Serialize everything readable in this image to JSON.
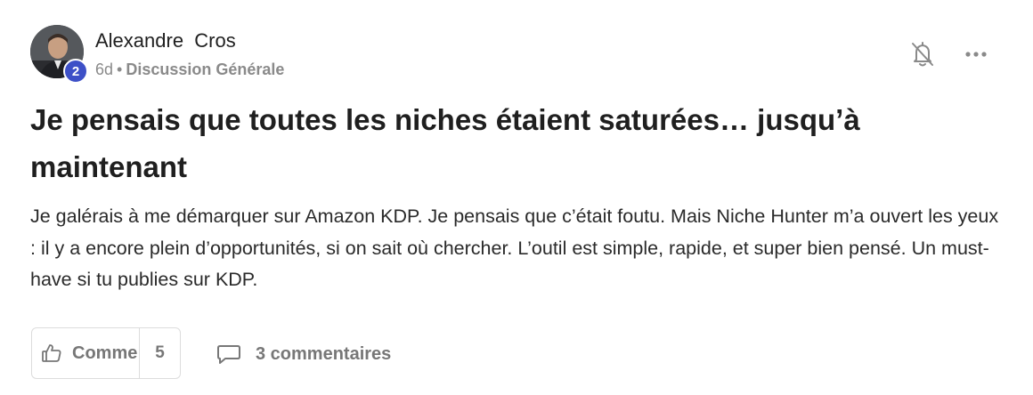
{
  "post": {
    "author": {
      "name": "Alexandre  Cros",
      "level": "2"
    },
    "meta": {
      "age": "6d",
      "separator": "•",
      "category": "Discussion Générale"
    },
    "title": "Je pensais que toutes les niches étaient saturées… jusqu’à maintenant",
    "body": "Je galérais à me démarquer sur Amazon KDP. Je pensais que c’était foutu. Mais Niche Hunter m’a ouvert les yeux : il y a encore plein d’opportunités, si on sait où chercher. L’outil est simple, rapide, et super bien pensé. Un must-have si tu publies sur KDP.",
    "actions": {
      "like_label": "Comme",
      "like_count": "5",
      "comments_label": "3 commentaires"
    },
    "icons": {
      "like": "thumbs-up-icon",
      "comment": "comment-bubble-icon",
      "notifications": "bell-off-icon",
      "more": "more-horizontal-icon"
    }
  }
}
